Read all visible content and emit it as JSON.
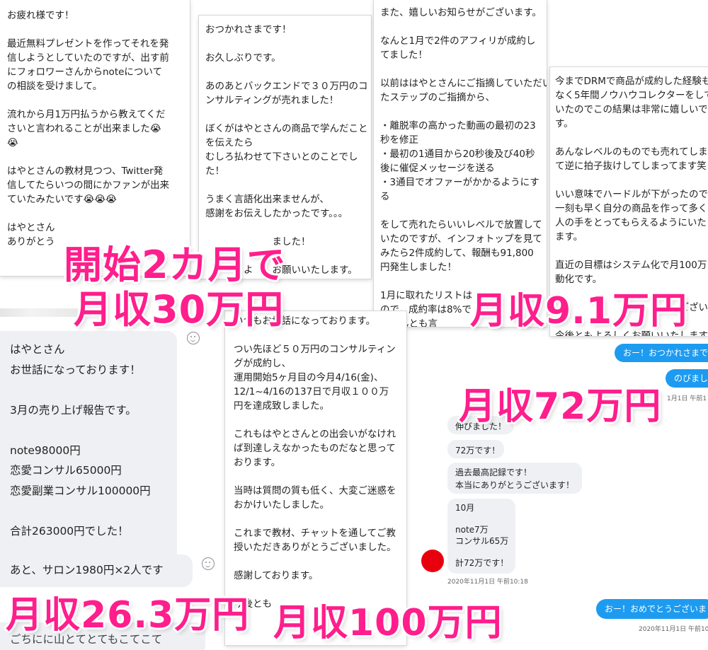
{
  "card1": {
    "lines": [
      "お疲れ様です！",
      "",
      "最近無料プレゼントを作ってそれを発",
      "信しようとしていたのですが、出す前",
      "にフォロワーさんからnoteについて",
      "の相談を受けまして。",
      "",
      "流れから月1万円払うから教えてくだ",
      "さいと言われることが出来ました😭",
      "😭",
      "",
      "はやとさんの教材見つつ、Twitter発",
      "信してたらいつの間にかファンが出来",
      "ていたみたいです😭😭😭",
      "",
      "はやとさん",
      "ありがとう"
    ]
  },
  "card2": {
    "lines": [
      "おつかれさまです！",
      "",
      "お久しぶりです。",
      "",
      "あのあとバックエンドで３０万円のコ",
      "ンサルティングが売れました！",
      "",
      "ぼくがはやとさんの商品で学んだこと",
      "を伝えたら",
      "むしろ払わせて下さいとのことでし",
      "た！",
      "",
      "うまく言語化出来ませんが、",
      "感謝をお伝えしたかったです。。。",
      "",
      "　　　　　　　ました！",
      "",
      "　　　　よ　　お願いいたします。"
    ]
  },
  "card3": {
    "lines": [
      "また、嬉しいお知らせがございます。",
      "",
      "なんと1月で2件のアフィリが成約し",
      "てました！",
      "",
      "以前ははやとさんにご指摘していただい",
      "たステップのご指摘から、",
      "",
      "・離脱率の高かった動画の最初の23",
      "秒を修正",
      "・最初の1通目から20秒後及び40秒",
      "後に催促メッセージを送る",
      "・3通目でオファーがかかるようにす",
      "る",
      "",
      "をして売れたらいいレベルで放置して",
      "いたのですが、インフォトップを見て",
      "みたら2件成約して、報酬も91,800",
      "円発生しました！",
      "",
      "1月に取れたリストは",
      "ので、成約率は8%で",
      "でなんとも言"
    ]
  },
  "card4": {
    "lines": [
      "今までDRMで商品が成約した経験も",
      "なく5年間ノウハウコレクターをして",
      "いたのでこの結果は非常に嬉しいで",
      "す。",
      "",
      "あんなレベルのものでも売れてしまっ",
      "て逆に拍子抜けしてしまってます笑",
      "",
      "いい意味でハードルが下がったので、",
      "一刻も早く自分の商品を作って多くの",
      "人の手をとってもらえるようにいたし",
      "ます。",
      "",
      "直近の目標はシステム化で月100万自",
      "動化です。",
      "",
      "　　　　　　　　　　　　　ござい",
      "",
      "今後ともよろしくお願いいたします"
    ]
  },
  "card5": {
    "lines": [
      "はやとさん",
      "お世話になっております！",
      "",
      "3月の売り上げ報告です。",
      "",
      "note98000円",
      "恋愛コンサル65000円",
      "恋愛副業コンサル100000円",
      "",
      "合計263000円でした！"
    ],
    "bubble2": "あと、サロン1980円×2人です",
    "bubble3": "ごちにに山とてとてもこてこて"
  },
  "card6": {
    "lines": [
      "いつもお世話になっております。",
      "",
      "つい先ほど５０万円のコンサルティン",
      "グが成約し、",
      "運用開始5ヶ月目の今月4/16(金)、",
      "12/1~4/16の137日で月収１００万",
      "円を達成致しました。",
      "",
      "これもはやとさんとの出会いがなけれ",
      "ば到達しえなかったものだなと思って",
      "おります。",
      "",
      "当時は質問の質も低く、大変ご迷惑を",
      "おかけいたしました。",
      "",
      "これまで教材、チャットを通してご教",
      "授いただきありがとうございました。",
      "",
      "感謝しております。",
      "",
      "今後とも"
    ]
  },
  "dm": {
    "out1": "おー！おつかれさまで",
    "out2": "のびまし",
    "time1": "1月1日 午前1",
    "in1": "伸びました！",
    "in2": "72万です！",
    "in3_l1": "過去最高記録です！",
    "in3_l2": "本当にありがとうございます！",
    "in4": [
      "10月",
      "",
      "note7万",
      "コンサル65万",
      "",
      "計72万です！"
    ],
    "time2": "2020年11月1日 午前10:18",
    "out3": "おー！おめでとうございま",
    "time3": "2020年11月1日 午前10"
  },
  "captions": {
    "c1a": "開始2カ月で",
    "c1b": "月収30万円",
    "c2": "月収9.1万円",
    "c3": "月収72万円",
    "c4": "月収26.3万円",
    "c5": "月収100万円"
  },
  "colors": {
    "caption": "#ff1e8c",
    "dm_blue": "#1d9bf0",
    "dm_grey": "#eef0f3",
    "avatar": "#e8000f"
  }
}
